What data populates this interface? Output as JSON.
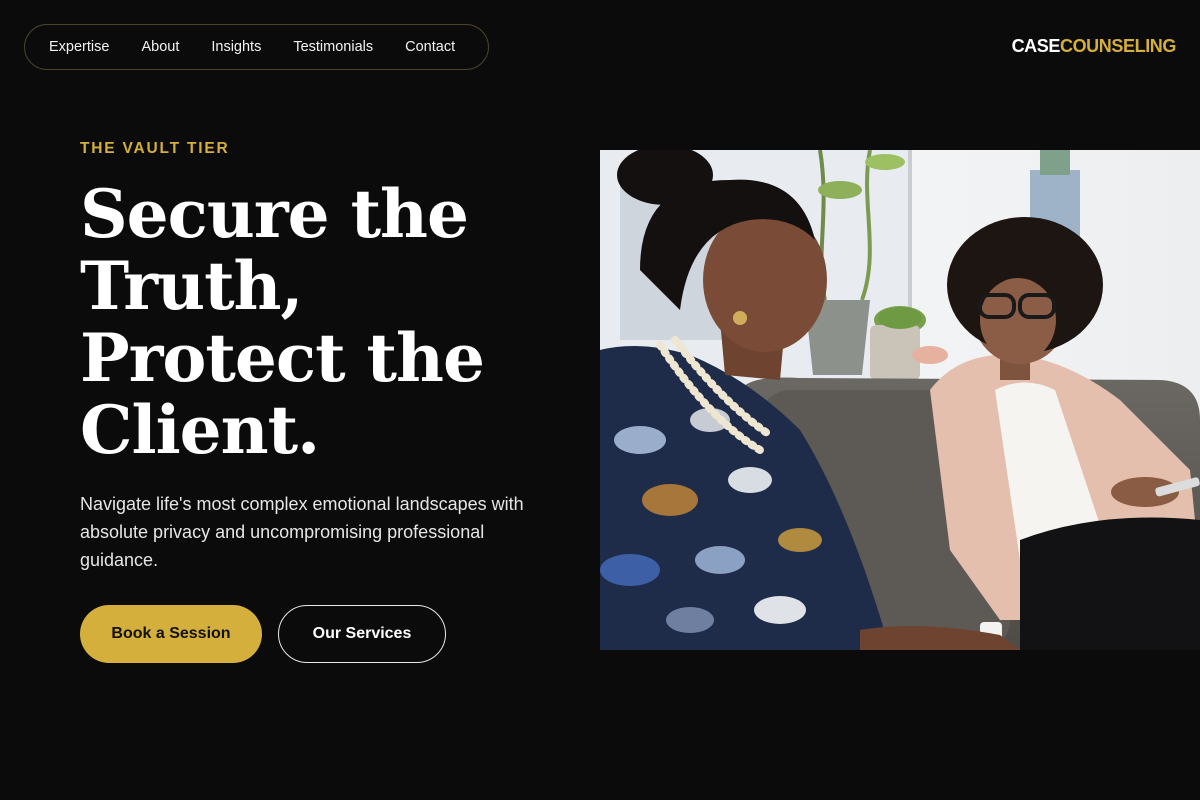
{
  "nav": {
    "links": [
      "Expertise",
      "About",
      "Insights",
      "Testimonials",
      "Contact"
    ]
  },
  "logo": {
    "part1": "CASE",
    "part2": "COUNSELING"
  },
  "hero": {
    "eyebrow": "THE VAULT TIER",
    "headline": [
      "Secure the",
      "Truth,",
      "Protect the",
      "Client."
    ],
    "subtext": "Navigate life's most complex emotional landscapes with absolute privacy and uncompromising professional guidance.",
    "primary_button": "Book a Session",
    "secondary_button": "Our Services"
  },
  "colors": {
    "background": "#0b0b0c",
    "accent": "#d4af3c",
    "text": "#ffffff"
  },
  "icons": {
    "photo": "counseling-session-photo"
  }
}
